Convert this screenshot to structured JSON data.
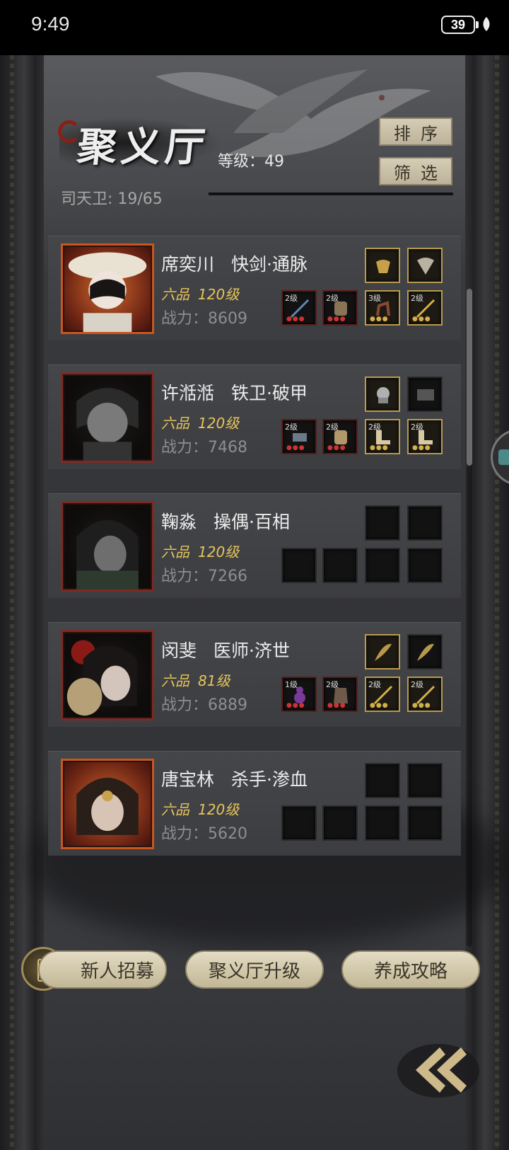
{
  "status": {
    "time": "9:49",
    "battery": "39"
  },
  "header": {
    "title": "聚义厅",
    "level": "等级：49",
    "guard_count": "司天卫: 19/65",
    "sort_label": "排序",
    "filter_label": "筛选"
  },
  "heroes": [
    {
      "name": "席奕川",
      "class": "快剑·通脉",
      "grade": "六品",
      "level": "120级",
      "power": "战力：8609",
      "slots": [
        {
          "lv": "2级"
        },
        {
          "lv": "2级"
        },
        {
          "lv": "3级"
        },
        {
          "lv": "2级"
        }
      ]
    },
    {
      "name": "许湉湉",
      "class": "铁卫·破甲",
      "grade": "六品",
      "level": "120级",
      "power": "战力：7468",
      "slots": [
        {
          "lv": "2级"
        },
        {
          "lv": "2级"
        },
        {
          "lv": "2级"
        },
        {
          "lv": "2级"
        }
      ]
    },
    {
      "name": "鞠淼",
      "class": "操偶·百相",
      "grade": "六品",
      "level": "120级",
      "power": "战力：7266",
      "slots": []
    },
    {
      "name": "闵斐",
      "class": "医师·济世",
      "grade": "六品",
      "level": "81级",
      "power": "战力：6889",
      "slots": [
        {
          "lv": "1级"
        },
        {
          "lv": "2级"
        },
        {
          "lv": "2级"
        },
        {
          "lv": "2级"
        }
      ]
    },
    {
      "name": "唐宝林",
      "class": "杀手·渗血",
      "grade": "六品",
      "level": "120级",
      "power": "战力：5620",
      "slots": []
    }
  ],
  "footer": {
    "recruit_label": "新人招募",
    "upgrade_label": "聚义厅升级",
    "guide_label": "养成攻略"
  },
  "colors": {
    "accent_gold": "#e6c55a",
    "button_bg": "#d6cdb6",
    "portrait_red": "#7d2a24",
    "portrait_orange": "#c9561f"
  },
  "icons": [
    "leaf-icon",
    "back-arrow-icon",
    "recruit-token-icon"
  ]
}
